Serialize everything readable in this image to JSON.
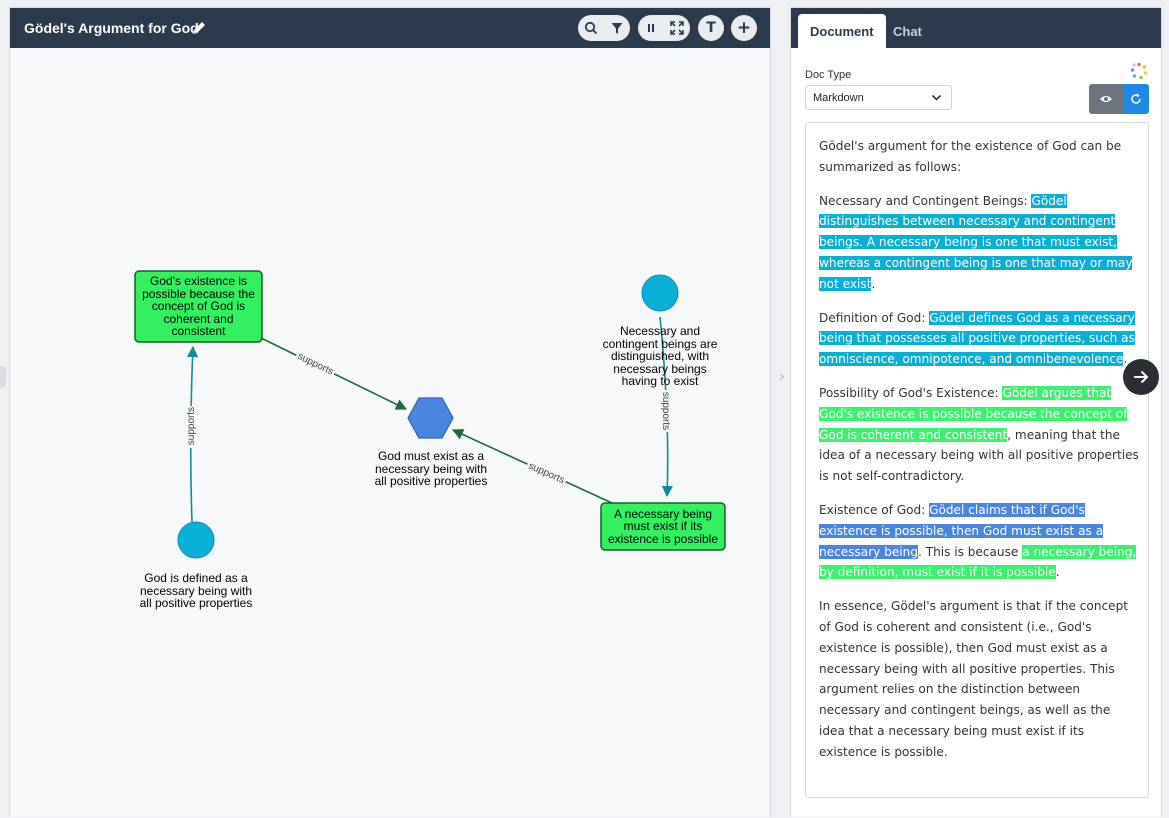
{
  "graph": {
    "title": "Gödel's Argument for God",
    "toolbar": {
      "search_icon": "search-icon",
      "filter_icon": "filter-icon",
      "pause_icon": "pause-icon",
      "fit_icon": "fit-screen-icon",
      "text_button_label": "T",
      "add_button_label": "+"
    },
    "nodes": {
      "possible": "God's existence is possible because the concept of God is coherent and consistent",
      "defined": "God is defined as a necessary being with all positive properties",
      "conclusion": "God must exist as a necessary being with all positive properties",
      "necessary_contingent": "Necessary and contingent beings are distinguished, with necessary beings having to exist",
      "must_exist": "A necessary being must exist if its existence is possible"
    },
    "edge_labels": {
      "possible_to_conclusion": "supports",
      "defined_to_possible": "supports",
      "must_exist_to_conclusion": "supports",
      "necessary_to_must_exist": "supports"
    },
    "colors": {
      "green_node": "#33f060",
      "cyan_node": "#0ab0d8",
      "blue_node": "#4a86e0",
      "edge_green": "#1d6b3a",
      "edge_teal": "#138a96"
    }
  },
  "doc": {
    "tabs": {
      "document": "Document",
      "chat": "Chat"
    },
    "doc_type_label": "Doc Type",
    "doc_type_value": "Markdown",
    "intro": "Gödel's argument for the existence of God can be summarized as follows:",
    "p1": {
      "lead": "Necessary and Contingent Beings: ",
      "highlight": "Gödel distinguishes between necessary and contingent beings. A necessary being is one that must exist, whereas a contingent being is one that may or may not exist",
      "tail": "."
    },
    "p2": {
      "lead": "Definition of God: ",
      "highlight": "Gödel defines God as a necessary being that possesses all positive properties, such as omniscience, omnipotence, and omnibenevolence",
      "tail": "."
    },
    "p3": {
      "lead": "Possibility of God's Existence: ",
      "highlight": "Gödel argues that God's existence is possible because the concept of God is coherent and consistent",
      "tail": ", meaning that the idea of a necessary being with all positive properties is not self-contradictory."
    },
    "p4": {
      "lead": "Existence of God: ",
      "highlight": "Gödel claims that if God's existence is possible, then God must exist as a necessary being",
      "mid": ". This is because ",
      "highlight2": "a necessary being, by definition, must exist if it is possible",
      "tail": "."
    },
    "conclusion": "In essence, Gödel's argument is that if the concept of God is coherent and consistent (i.e., God's existence is possible), then God must exist as a necessary being with all positive properties. This argument relies on the distinction between necessary and contingent beings, as well as the idea that a necessary being must exist if its existence is possible."
  }
}
